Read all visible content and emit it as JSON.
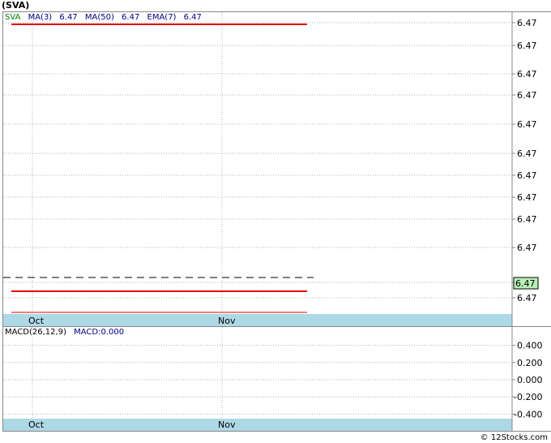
{
  "title": "(SVA)",
  "legend": {
    "ticker": "SVA",
    "ma3_label": "MA(3)",
    "ma3_value": "6.47",
    "ma50_label": "MA(50)",
    "ma50_value": "6.47",
    "ema7_label": "EMA(7)",
    "ema7_value": "6.47"
  },
  "macd_legend": {
    "params": "MACD(26,12,9)",
    "value_label": "MACD:0.000"
  },
  "footer": "© 12Stocks.com",
  "colors": {
    "price_line": "#e00000",
    "axis_band": "#add8e6",
    "grid": "#b0b0b0",
    "ticker": "#008000",
    "legend_blue": "#000080",
    "current_price_bg": "#b8f0b8"
  },
  "chart_data": [
    {
      "type": "line",
      "title": "(SVA)",
      "x_tick_labels": [
        "Oct",
        "Nov"
      ],
      "y_tick_labels": [
        "6.47",
        "6.47",
        "6.47",
        "6.47",
        "6.47",
        "6.47",
        "6.47",
        "6.47",
        "6.47",
        "6.47",
        "6.47",
        "6.47"
      ],
      "current_price_label": "6.47",
      "series": [
        {
          "name": "SVA",
          "values": [
            6.47,
            6.47
          ]
        },
        {
          "name": "MA(3)",
          "values": [
            6.47,
            6.47
          ]
        },
        {
          "name": "MA(50)",
          "values": [
            6.47,
            6.47
          ]
        },
        {
          "name": "EMA(7)",
          "values": [
            6.47,
            6.47
          ]
        }
      ],
      "grid": true
    },
    {
      "type": "line",
      "title": "MACD(26,12,9)",
      "x_tick_labels": [
        "Oct",
        "Nov"
      ],
      "y_tick_labels": [
        "0.400",
        "0.200",
        "0.000",
        "-0.200",
        "-0.400"
      ],
      "y_ticks": [
        0.4,
        0.2,
        0.0,
        -0.2,
        -0.4
      ],
      "ylim": [
        -0.5,
        0.5
      ],
      "series": [
        {
          "name": "MACD",
          "values": [
            0.0,
            0.0
          ]
        }
      ],
      "grid": true
    }
  ]
}
